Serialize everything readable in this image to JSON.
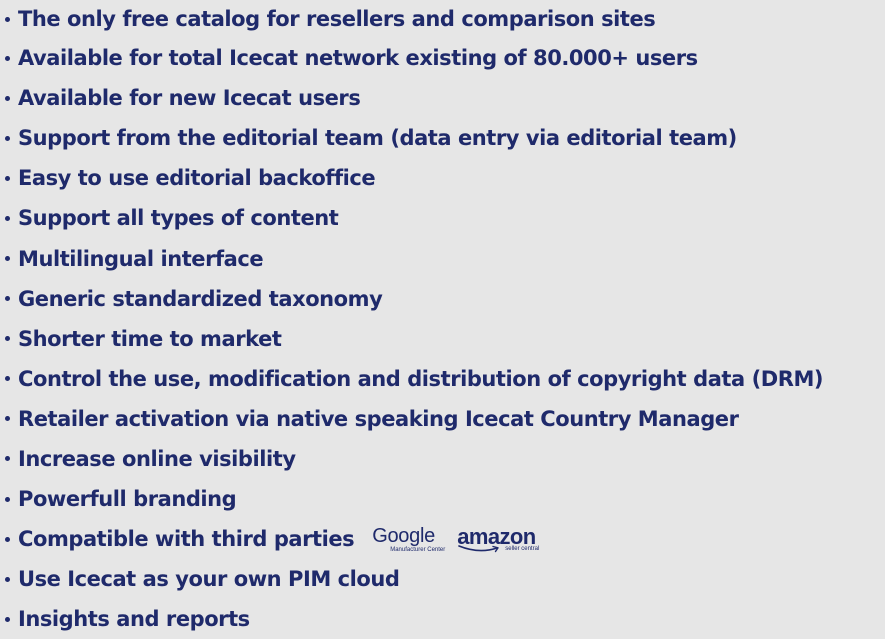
{
  "features": [
    "The only free catalog for resellers and comparison sites",
    "Available for total Icecat network existing of 80.000+ users",
    "Available for new Icecat users",
    "Support from the editorial team (data entry via editorial team)",
    "Easy to use editorial backoffice",
    "Support all types of content",
    "Multilingual interface",
    "Generic standardized taxonomy",
    "Shorter time to market",
    "Control the use, modification and distribution of copyright data (DRM)",
    "Retailer activation via native speaking Icecat Country Manager",
    "Increase online visibility",
    "Powerfull branding",
    "Compatible with third parties",
    "Use Icecat as your own PIM cloud",
    "Insights and reports"
  ],
  "logos": {
    "google": {
      "word": "Google",
      "sub": "Manufacturer Center"
    },
    "amazon": {
      "word": "amazon",
      "sub": "seller central"
    }
  },
  "colors": {
    "background": "#e6e6e6",
    "text": "#1f2a6b"
  }
}
